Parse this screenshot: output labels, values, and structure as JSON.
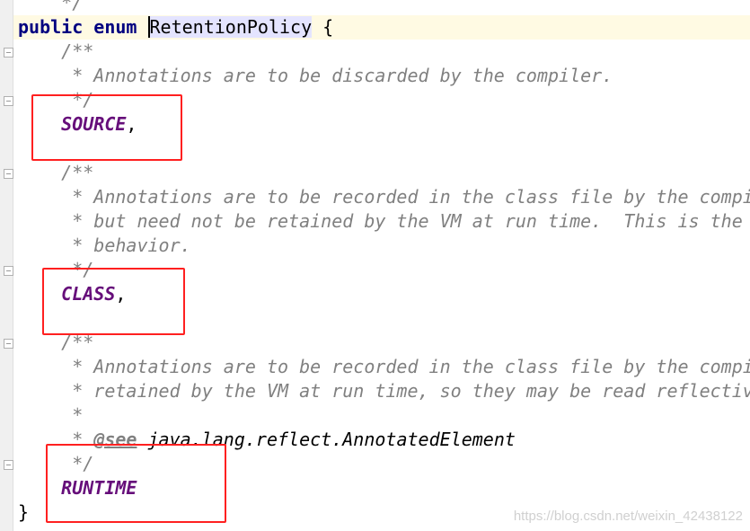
{
  "editor": {
    "colors": {
      "keyword": "#000080",
      "comment": "#808080",
      "enum_constant": "#660e7a",
      "current_line": "#fffae3",
      "selection": "#e4e4ff",
      "highlight_box": "#ff2020"
    },
    "lines": [
      [
        [
          "cm",
          "    */"
        ]
      ],
      [
        [
          "kw",
          "public "
        ],
        [
          "kw",
          "enum "
        ],
        [
          "sel",
          "RetentionPolicy"
        ],
        [
          "pl",
          " {"
        ]
      ],
      [
        [
          "cm",
          "    /**"
        ]
      ],
      [
        [
          "cm",
          "     * Annotations are to be discarded by the compiler."
        ]
      ],
      [
        [
          "cm",
          "     */"
        ]
      ],
      [
        [
          "pl",
          "    "
        ],
        [
          "en",
          "SOURCE"
        ],
        [
          "pl",
          ","
        ]
      ],
      [],
      [
        [
          "cm",
          "    /**"
        ]
      ],
      [
        [
          "cm",
          "     * Annotations are to be recorded in the class file by the compi"
        ]
      ],
      [
        [
          "cm",
          "     * but need not be retained by the VM at run time.  This is the"
        ]
      ],
      [
        [
          "cm",
          "     * behavior."
        ]
      ],
      [
        [
          "cm",
          "     */"
        ]
      ],
      [
        [
          "pl",
          "    "
        ],
        [
          "en",
          "CLASS"
        ],
        [
          "pl",
          ","
        ]
      ],
      [],
      [
        [
          "cm",
          "    /**"
        ]
      ],
      [
        [
          "cm",
          "     * Annotations are to be recorded in the class file by the compi"
        ]
      ],
      [
        [
          "cm",
          "     * retained by the VM at run time, so they may be read reflectiv"
        ]
      ],
      [
        [
          "cm",
          "     *"
        ]
      ],
      [
        [
          "cm",
          "     * "
        ],
        [
          "tag",
          "@see"
        ],
        [
          "ref",
          " java.lang.reflect.AnnotatedElement"
        ]
      ],
      [
        [
          "cm",
          "     */"
        ]
      ],
      [
        [
          "pl",
          "    "
        ],
        [
          "en",
          "RUNTIME"
        ]
      ],
      [
        [
          "pl",
          "}"
        ]
      ]
    ],
    "current_line": 1
  },
  "watermark": "https://blog.csdn.net/weixin_42438122"
}
